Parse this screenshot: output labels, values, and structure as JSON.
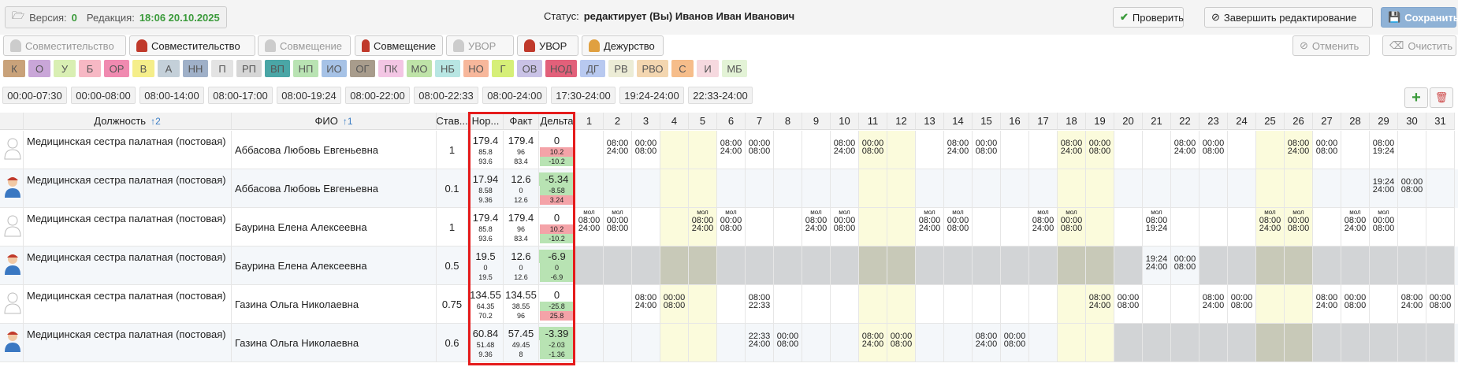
{
  "topbar": {
    "version_label": "Версия:",
    "version_value": "0",
    "revision_label": "Редакция:",
    "revision_value": "18:06 20.10.2025",
    "status_label": "Статус:",
    "status_value": "редактирует (Вы) Иванов Иван Иванович",
    "check_label": "Проверить",
    "finish_label": "Завершить редактирование",
    "save_label": "Сохранить",
    "cancel_label": "Отменить",
    "clear_label": "Очистить"
  },
  "shift_types": [
    "Совместительство",
    "Совместительство",
    "Совмещение",
    "Совмещение",
    "УВОР",
    "УВОР",
    "Дежурство"
  ],
  "codes": [
    {
      "label": "К",
      "color": "#c9a27a"
    },
    {
      "label": "О",
      "color": "#c9a6d8"
    },
    {
      "label": "У",
      "color": "#d9efb3"
    },
    {
      "label": "Б",
      "color": "#f7b8c4"
    },
    {
      "label": "ОР",
      "color": "#f08ab0"
    },
    {
      "label": "В",
      "color": "#f5ee8a"
    },
    {
      "label": "А",
      "color": "#c4d0d9"
    },
    {
      "label": "НН",
      "color": "#9fb0c8"
    },
    {
      "label": "П",
      "color": "#e3e3e3"
    },
    {
      "label": "РП",
      "color": "#d6d6d6"
    },
    {
      "label": "ВП",
      "color": "#4aa6a6"
    },
    {
      "label": "НП",
      "color": "#b9e3b3"
    },
    {
      "label": "ИО",
      "color": "#a6c2e6"
    },
    {
      "label": "ОГ",
      "color": "#a89c8c"
    },
    {
      "label": "ПК",
      "color": "#f3c6e4"
    },
    {
      "label": "МО",
      "color": "#bfe3a8"
    },
    {
      "label": "НБ",
      "color": "#b8e6e3"
    },
    {
      "label": "НО",
      "color": "#f7b79b"
    },
    {
      "label": "Г",
      "color": "#d6ef78"
    },
    {
      "label": "ОВ",
      "color": "#c9c2e6"
    },
    {
      "label": "НОД",
      "color": "#e2607a"
    },
    {
      "label": "ДГ",
      "color": "#b8c9f0"
    },
    {
      "label": "РВ",
      "color": "#ececd6"
    },
    {
      "label": "РВО",
      "color": "#f3d6b0"
    },
    {
      "label": "С",
      "color": "#f6bd8a"
    },
    {
      "label": "И",
      "color": "#f6d9df"
    },
    {
      "label": "МБ",
      "color": "#e3f3d6"
    }
  ],
  "time_presets": [
    "00:00-07:30",
    "00:00-08:00",
    "08:00-14:00",
    "08:00-17:00",
    "08:00-19:24",
    "08:00-22:00",
    "08:00-22:33",
    "08:00-24:00",
    "17:30-24:00",
    "19:24-24:00",
    "22:33-24:00"
  ],
  "table": {
    "headers": {
      "position": "Должность",
      "position_sort": "2",
      "fio": "ФИО",
      "fio_sort": "1",
      "rate": "Став...",
      "norm": "Нор...",
      "fact": "Факт",
      "delta": "Дельта"
    },
    "days": [
      "1",
      "2",
      "3",
      "4",
      "5",
      "6",
      "7",
      "8",
      "9",
      "10",
      "11",
      "12",
      "13",
      "14",
      "15",
      "16",
      "17",
      "18",
      "19",
      "20",
      "21",
      "22",
      "23",
      "24",
      "25",
      "26",
      "27",
      "28",
      "29",
      "30",
      "31"
    ],
    "mol": "мол",
    "rows": [
      {
        "position": "Медицинская сестра палатная (постовая)",
        "fio": "Аббасова Любовь Евгеньевна",
        "rate": "1",
        "avatar": "grey",
        "norm": {
          "main": "179.4",
          "a": "85.8",
          "b": "93.6"
        },
        "fact": {
          "main": "179.4",
          "a": "96",
          "b": "83.4"
        },
        "delta": {
          "main": "0",
          "a": "10.2",
          "b": "-10.2"
        },
        "days": {
          "2": [
            "08:00",
            "24:00"
          ],
          "3": [
            "00:00",
            "08:00"
          ],
          "6": [
            "08:00",
            "24:00"
          ],
          "7": [
            "00:00",
            "08:00"
          ],
          "10": [
            "08:00",
            "24:00"
          ],
          "11": [
            "00:00",
            "08:00"
          ],
          "14": [
            "08:00",
            "24:00"
          ],
          "15": [
            "00:00",
            "08:00"
          ],
          "18": [
            "08:00",
            "24:00"
          ],
          "19": [
            "00:00",
            "08:00"
          ],
          "22": [
            "08:00",
            "24:00"
          ],
          "23": [
            "00:00",
            "08:00"
          ],
          "26": [
            "08:00",
            "24:00"
          ],
          "27": [
            "00:00",
            "08:00"
          ],
          "29": [
            "08:00",
            "19:24"
          ]
        }
      },
      {
        "position": "Медицинская сестра палатная (постовая)",
        "fio": "Аббасова Любовь Евгеньевна",
        "rate": "0.1",
        "avatar": "blue",
        "norm": {
          "main": "17.94",
          "a": "8.58",
          "b": "9.36"
        },
        "fact": {
          "main": "12.6",
          "a": "0",
          "b": "12.6"
        },
        "delta": {
          "main": "-5.34",
          "a": "-8.58",
          "b": "3.24"
        },
        "days": {
          "29": [
            "19:24",
            "24:00"
          ],
          "30": [
            "00:00",
            "08:00"
          ]
        }
      },
      {
        "position": "Медицинская сестра палатная (постовая)",
        "fio": "Баурина Елена Алексеевна",
        "rate": "1",
        "avatar": "grey",
        "norm": {
          "main": "179.4",
          "a": "85.8",
          "b": "93.6"
        },
        "fact": {
          "main": "179.4",
          "a": "96",
          "b": "83.4"
        },
        "delta": {
          "main": "0",
          "a": "10.2",
          "b": "-10.2"
        },
        "days": {
          "1": [
            "08:00",
            "24:00"
          ],
          "2": [
            "00:00",
            "08:00"
          ],
          "5": [
            "08:00",
            "24:00"
          ],
          "6": [
            "00:00",
            "08:00"
          ],
          "9": [
            "08:00",
            "24:00"
          ],
          "10": [
            "00:00",
            "08:00"
          ],
          "13": [
            "08:00",
            "24:00"
          ],
          "14": [
            "00:00",
            "08:00"
          ],
          "17": [
            "08:00",
            "24:00"
          ],
          "18": [
            "00:00",
            "08:00"
          ],
          "21": [
            "08:00",
            "19:24"
          ],
          "25": [
            "08:00",
            "24:00"
          ],
          "26": [
            "00:00",
            "08:00"
          ],
          "28": [
            "08:00",
            "24:00"
          ],
          "29": [
            "00:00",
            "08:00"
          ]
        },
        "mol_days": [
          "1",
          "2",
          "5",
          "6",
          "9",
          "10",
          "13",
          "14",
          "17",
          "18",
          "21",
          "25",
          "26",
          "28",
          "29"
        ]
      },
      {
        "position": "Медицинская сестра палатная (постовая)",
        "fio": "Баурина Елена Алексеевна",
        "rate": "0.5",
        "avatar": "blue",
        "norm": {
          "main": "19.5",
          "a": "0",
          "b": "19.5"
        },
        "fact": {
          "main": "12.6",
          "a": "0",
          "b": "12.6"
        },
        "delta": {
          "main": "-6.9",
          "a": "0",
          "b": "-6.9"
        },
        "days": {
          "21": [
            "19:24",
            "24:00"
          ],
          "22": [
            "00:00",
            "08:00"
          ]
        },
        "grey_days": [
          "1",
          "2",
          "3",
          "4",
          "5",
          "6",
          "7",
          "8",
          "9",
          "10",
          "11",
          "12",
          "13",
          "14",
          "15",
          "16",
          "17",
          "18",
          "19",
          "20",
          "23",
          "24",
          "25",
          "26",
          "27",
          "28",
          "29",
          "30",
          "31"
        ]
      },
      {
        "position": "Медицинская сестра палатная (постовая)",
        "fio": "Газина Ольга Николаевна",
        "rate": "0.75",
        "avatar": "grey",
        "norm": {
          "main": "134.55",
          "a": "64.35",
          "b": "70.2"
        },
        "fact": {
          "main": "134.55",
          "a": "38.55",
          "b": "96"
        },
        "delta": {
          "main": "0",
          "a": "-25.8",
          "b": "25.8"
        },
        "days": {
          "3": [
            "08:00",
            "24:00"
          ],
          "4": [
            "00:00",
            "08:00"
          ],
          "7": [
            "08:00",
            "22:33"
          ],
          "19": [
            "08:00",
            "24:00"
          ],
          "20": [
            "00:00",
            "08:00"
          ],
          "23": [
            "08:00",
            "24:00"
          ],
          "24": [
            "00:00",
            "08:00"
          ],
          "27": [
            "08:00",
            "24:00"
          ],
          "28": [
            "00:00",
            "08:00"
          ],
          "30": [
            "08:00",
            "24:00"
          ],
          "31": [
            "00:00",
            "08:00"
          ]
        }
      },
      {
        "position": "Медицинская сестра палатная (постовая)",
        "fio": "Газина Ольга Николаевна",
        "rate": "0.6",
        "avatar": "blue",
        "norm": {
          "main": "60.84",
          "a": "51.48",
          "b": "9.36"
        },
        "fact": {
          "main": "57.45",
          "a": "49.45",
          "b": "8"
        },
        "delta": {
          "main": "-3.39",
          "a": "-2.03",
          "b": "-1.36"
        },
        "days": {
          "7": [
            "22:33",
            "24:00"
          ],
          "8": [
            "00:00",
            "08:00"
          ],
          "11": [
            "08:00",
            "24:00"
          ],
          "12": [
            "00:00",
            "08:00"
          ],
          "15": [
            "08:00",
            "24:00"
          ],
          "16": [
            "00:00",
            "08:00"
          ]
        },
        "grey_days": [
          "20",
          "21",
          "22",
          "23",
          "24",
          "25",
          "26",
          "27",
          "28",
          "29",
          "30",
          "31"
        ]
      }
    ]
  },
  "colors": {
    "weekend": "#fbfbdc",
    "grey_day": "#d2d4d6",
    "pos": "#b8e3b3",
    "neg": "#f4a3a8",
    "accent": "#3a9a3a"
  }
}
